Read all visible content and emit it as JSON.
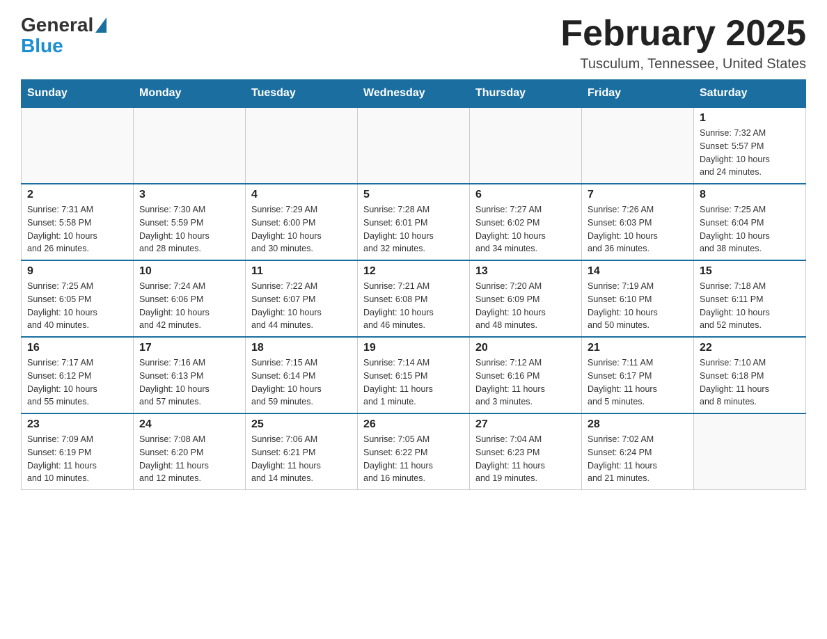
{
  "header": {
    "month_title": "February 2025",
    "location": "Tusculum, Tennessee, United States",
    "logo_general": "General",
    "logo_blue": "Blue"
  },
  "days_of_week": [
    "Sunday",
    "Monday",
    "Tuesday",
    "Wednesday",
    "Thursday",
    "Friday",
    "Saturday"
  ],
  "weeks": [
    [
      {
        "day": "",
        "info": ""
      },
      {
        "day": "",
        "info": ""
      },
      {
        "day": "",
        "info": ""
      },
      {
        "day": "",
        "info": ""
      },
      {
        "day": "",
        "info": ""
      },
      {
        "day": "",
        "info": ""
      },
      {
        "day": "1",
        "info": "Sunrise: 7:32 AM\nSunset: 5:57 PM\nDaylight: 10 hours\nand 24 minutes."
      }
    ],
    [
      {
        "day": "2",
        "info": "Sunrise: 7:31 AM\nSunset: 5:58 PM\nDaylight: 10 hours\nand 26 minutes."
      },
      {
        "day": "3",
        "info": "Sunrise: 7:30 AM\nSunset: 5:59 PM\nDaylight: 10 hours\nand 28 minutes."
      },
      {
        "day": "4",
        "info": "Sunrise: 7:29 AM\nSunset: 6:00 PM\nDaylight: 10 hours\nand 30 minutes."
      },
      {
        "day": "5",
        "info": "Sunrise: 7:28 AM\nSunset: 6:01 PM\nDaylight: 10 hours\nand 32 minutes."
      },
      {
        "day": "6",
        "info": "Sunrise: 7:27 AM\nSunset: 6:02 PM\nDaylight: 10 hours\nand 34 minutes."
      },
      {
        "day": "7",
        "info": "Sunrise: 7:26 AM\nSunset: 6:03 PM\nDaylight: 10 hours\nand 36 minutes."
      },
      {
        "day": "8",
        "info": "Sunrise: 7:25 AM\nSunset: 6:04 PM\nDaylight: 10 hours\nand 38 minutes."
      }
    ],
    [
      {
        "day": "9",
        "info": "Sunrise: 7:25 AM\nSunset: 6:05 PM\nDaylight: 10 hours\nand 40 minutes."
      },
      {
        "day": "10",
        "info": "Sunrise: 7:24 AM\nSunset: 6:06 PM\nDaylight: 10 hours\nand 42 minutes."
      },
      {
        "day": "11",
        "info": "Sunrise: 7:22 AM\nSunset: 6:07 PM\nDaylight: 10 hours\nand 44 minutes."
      },
      {
        "day": "12",
        "info": "Sunrise: 7:21 AM\nSunset: 6:08 PM\nDaylight: 10 hours\nand 46 minutes."
      },
      {
        "day": "13",
        "info": "Sunrise: 7:20 AM\nSunset: 6:09 PM\nDaylight: 10 hours\nand 48 minutes."
      },
      {
        "day": "14",
        "info": "Sunrise: 7:19 AM\nSunset: 6:10 PM\nDaylight: 10 hours\nand 50 minutes."
      },
      {
        "day": "15",
        "info": "Sunrise: 7:18 AM\nSunset: 6:11 PM\nDaylight: 10 hours\nand 52 minutes."
      }
    ],
    [
      {
        "day": "16",
        "info": "Sunrise: 7:17 AM\nSunset: 6:12 PM\nDaylight: 10 hours\nand 55 minutes."
      },
      {
        "day": "17",
        "info": "Sunrise: 7:16 AM\nSunset: 6:13 PM\nDaylight: 10 hours\nand 57 minutes."
      },
      {
        "day": "18",
        "info": "Sunrise: 7:15 AM\nSunset: 6:14 PM\nDaylight: 10 hours\nand 59 minutes."
      },
      {
        "day": "19",
        "info": "Sunrise: 7:14 AM\nSunset: 6:15 PM\nDaylight: 11 hours\nand 1 minute."
      },
      {
        "day": "20",
        "info": "Sunrise: 7:12 AM\nSunset: 6:16 PM\nDaylight: 11 hours\nand 3 minutes."
      },
      {
        "day": "21",
        "info": "Sunrise: 7:11 AM\nSunset: 6:17 PM\nDaylight: 11 hours\nand 5 minutes."
      },
      {
        "day": "22",
        "info": "Sunrise: 7:10 AM\nSunset: 6:18 PM\nDaylight: 11 hours\nand 8 minutes."
      }
    ],
    [
      {
        "day": "23",
        "info": "Sunrise: 7:09 AM\nSunset: 6:19 PM\nDaylight: 11 hours\nand 10 minutes."
      },
      {
        "day": "24",
        "info": "Sunrise: 7:08 AM\nSunset: 6:20 PM\nDaylight: 11 hours\nand 12 minutes."
      },
      {
        "day": "25",
        "info": "Sunrise: 7:06 AM\nSunset: 6:21 PM\nDaylight: 11 hours\nand 14 minutes."
      },
      {
        "day": "26",
        "info": "Sunrise: 7:05 AM\nSunset: 6:22 PM\nDaylight: 11 hours\nand 16 minutes."
      },
      {
        "day": "27",
        "info": "Sunrise: 7:04 AM\nSunset: 6:23 PM\nDaylight: 11 hours\nand 19 minutes."
      },
      {
        "day": "28",
        "info": "Sunrise: 7:02 AM\nSunset: 6:24 PM\nDaylight: 11 hours\nand 21 minutes."
      },
      {
        "day": "",
        "info": ""
      }
    ]
  ]
}
